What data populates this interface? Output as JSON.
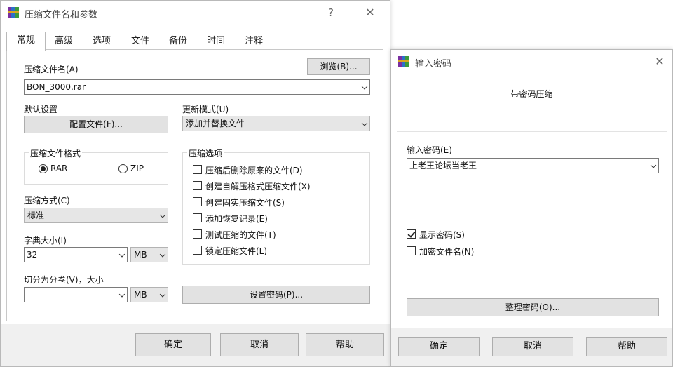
{
  "main_dialog": {
    "title": "压缩文件名和参数",
    "help_btn": "?",
    "close_btn": "✕",
    "tabs": [
      "常规",
      "高级",
      "选项",
      "文件",
      "备份",
      "时间",
      "注释"
    ],
    "archive_name_label": "压缩文件名(A)",
    "browse_button": "浏览(B)...",
    "archive_name_value": "BON_3000.rar",
    "default_settings_label": "默认设置",
    "profiles_button": "配置文件(F)...",
    "update_mode_label": "更新模式(U)",
    "update_mode_value": "添加并替换文件",
    "format_group_title": "压缩文件格式",
    "format_rar": "RAR",
    "format_zip": "ZIP",
    "options_group_title": "压缩选项",
    "options": [
      {
        "label": "压缩后删除原来的文件(D)",
        "checked": false
      },
      {
        "label": "创建自解压格式压缩文件(X)",
        "checked": false
      },
      {
        "label": "创建固实压缩文件(S)",
        "checked": false
      },
      {
        "label": "添加恢复记录(E)",
        "checked": false
      },
      {
        "label": "测试压缩的文件(T)",
        "checked": false
      },
      {
        "label": "锁定压缩文件(L)",
        "checked": false
      }
    ],
    "method_label": "压缩方式(C)",
    "method_value": "标准",
    "dict_label": "字典大小(I)",
    "dict_value": "32",
    "dict_unit": "MB",
    "split_label": "切分为分卷(V)，大小",
    "split_value": "",
    "split_unit": "MB",
    "set_password_button": "设置密码(P)...",
    "ok_button": "确定",
    "cancel_button": "取消",
    "help_button": "帮助"
  },
  "password_dialog": {
    "title": "输入密码",
    "close_btn": "✕",
    "heading": "带密码压缩",
    "enter_password_label": "输入密码(E)",
    "password_value": "上老王论坛当老王",
    "show_password_label": "显示密码(S)",
    "show_password_checked": true,
    "encrypt_names_label": "加密文件名(N)",
    "encrypt_names_checked": false,
    "organize_button": "整理密码(O)...",
    "ok_button": "确定",
    "cancel_button": "取消",
    "help_button": "帮助"
  },
  "colors": {
    "button_face": "#e2e2e2",
    "button_border": "#adadad",
    "footer_bg": "#f0f0f0"
  },
  "icons": {
    "app_icon": "winrar-books-icon",
    "dropdown": "chevron-down-icon"
  }
}
